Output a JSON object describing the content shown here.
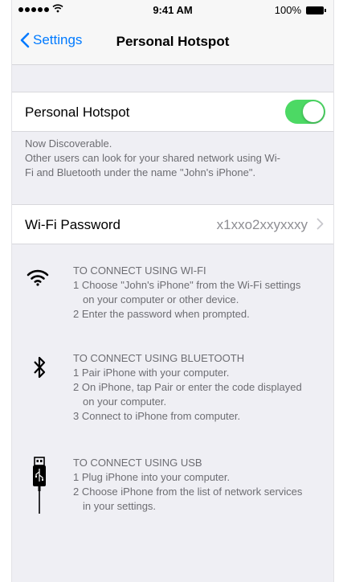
{
  "status_bar": {
    "time": "9:41 AM",
    "battery": "100%"
  },
  "nav": {
    "back_label": "Settings",
    "title": "Personal Hotspot"
  },
  "hotspot": {
    "label": "Personal Hotspot",
    "enabled": true,
    "note_line1": "Now Discoverable.",
    "note_line2": "Other users can look for your shared network using Wi-",
    "note_line3": "Fi and Bluetooth under the name \"John's iPhone\"."
  },
  "wifi_password": {
    "label": "Wi-Fi Password",
    "value": "x1xxo2xxyxxxy"
  },
  "instructions": {
    "wifi": {
      "title": "TO CONNECT USING WI-FI",
      "l1": "1 Choose \"John's iPhone\" from the Wi-Fi settings",
      "l1b": "on your computer or other device.",
      "l2": "2 Enter the password when prompted."
    },
    "bluetooth": {
      "title": "TO CONNECT USING BLUETOOTH",
      "l1": "1 Pair iPhone with your computer.",
      "l2": "2 On iPhone, tap Pair or enter the code displayed",
      "l2b": "on your computer.",
      "l3": "3 Connect to iPhone from computer."
    },
    "usb": {
      "title": "TO CONNECT USING USB",
      "l1": "1 Plug iPhone into your computer.",
      "l2": "2 Choose iPhone from the list of network services",
      "l2b": "in your settings."
    }
  },
  "colors": {
    "accent": "#007aff",
    "toggle_on": "#4cd964",
    "background": "#efeff4",
    "secondary_text": "#6d6d72"
  }
}
